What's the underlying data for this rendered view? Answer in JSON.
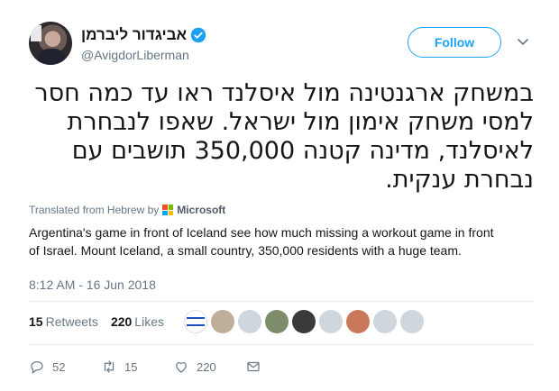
{
  "user": {
    "display_name": "אביגדור ליברמן",
    "handle": "@AvigdorLiberman"
  },
  "follow_label": "Follow",
  "tweet_text": "במשחק ארגנטינה מול איסלנד ראו עד כמה חסר למסי משחק אימון מול ישראל. שאפו לנבחרת לאיסלנד, מדינה קטנה 350,000 תושבים עם נבחרת ענקית.",
  "translation": {
    "label": "Translated from Hebrew by",
    "provider": "Microsoft",
    "text": "Argentina's game in front of Iceland see how much missing a workout game in front of Israel. Mount Iceland, a small country, 350,000 residents with a huge team."
  },
  "timestamp": "8:12 AM - 16 Jun 2018",
  "stats": {
    "retweets_count": "15",
    "retweets_label": "Retweets",
    "likes_count": "220",
    "likes_label": "Likes"
  },
  "actions": {
    "reply_count": "52",
    "retweet_count": "15",
    "like_count": "220"
  },
  "colors": {
    "accent": "#1da1f2",
    "secondary_text": "#657786"
  }
}
